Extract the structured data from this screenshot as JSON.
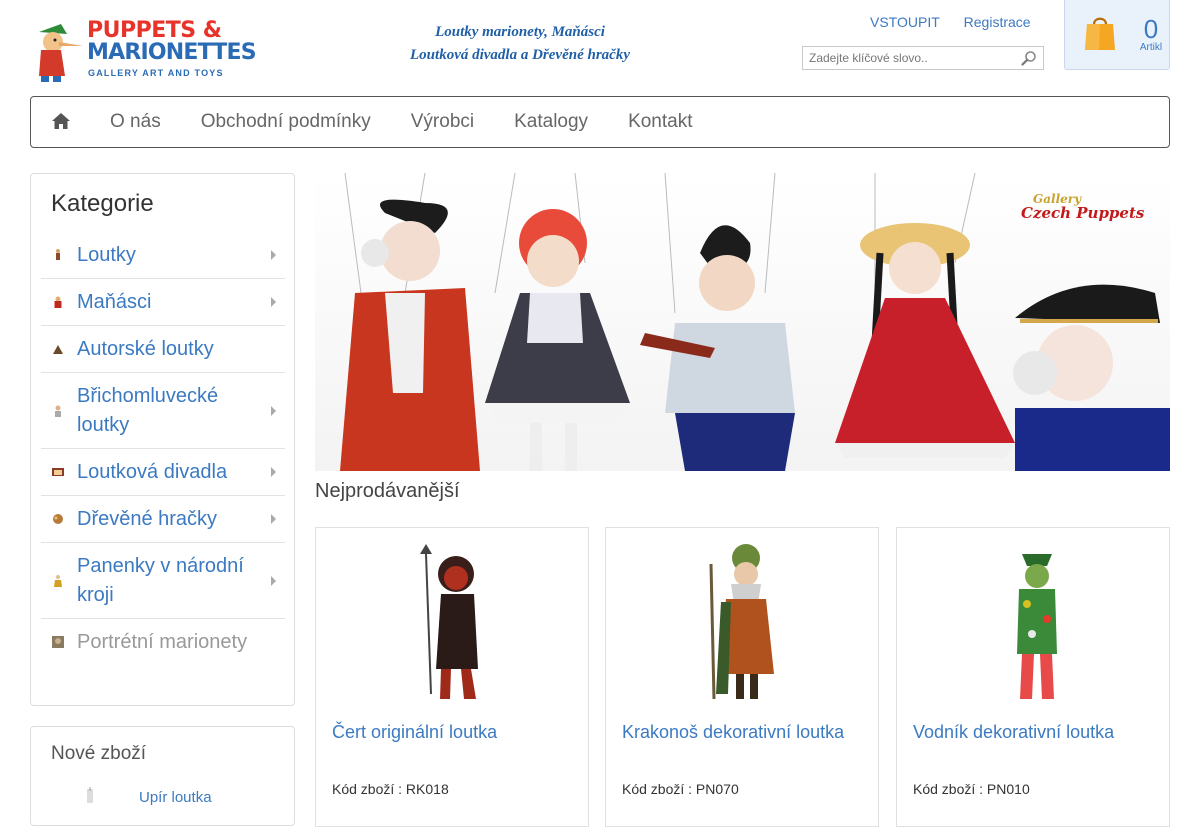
{
  "header": {
    "logo": {
      "line1": "PUPPETS &",
      "line2": "MARIONETTES",
      "line3": "GALLERY ART AND TOYS"
    },
    "tagline_1": "Loutky marionety, Maňásci",
    "tagline_2": "Loutková divadla a Dřevěné hračky",
    "login": "VSTOUPIT",
    "register": "Registrace",
    "search_placeholder": "Zadejte klíčové slovo..",
    "cart": {
      "count": "0",
      "label": "Artikl"
    }
  },
  "nav": {
    "items": [
      "O nás",
      "Obchodní podmínky",
      "Výrobci",
      "Katalogy",
      "Kontakt"
    ]
  },
  "sidebar": {
    "title": "Kategorie",
    "categories": [
      {
        "label": "Loutky",
        "has_sub": true
      },
      {
        "label": "Maňásci",
        "has_sub": true
      },
      {
        "label": "Autorské loutky",
        "has_sub": false
      },
      {
        "label": "Břichomluvecké loutky",
        "has_sub": true
      },
      {
        "label": "Loutková divadla",
        "has_sub": true
      },
      {
        "label": "Dřevěné hračky",
        "has_sub": true
      },
      {
        "label": "Panenky v národní kroji",
        "has_sub": true
      },
      {
        "label": "Portrétní marionety",
        "has_sub": false
      }
    ],
    "new_title": "Nové zboží",
    "new_item": "Upír loutka"
  },
  "banner": {
    "line1": "Gallery",
    "line2": "Czech Puppets"
  },
  "main": {
    "section_title": "Nejprodávanější",
    "products": [
      {
        "name": "Čert originální loutka",
        "code": "Kód zboží : RK018"
      },
      {
        "name": "Krakonoš dekorativní loutka",
        "code": "Kód zboží : PN070"
      },
      {
        "name": "Vodník dekorativní loutka",
        "code": "Kód zboží : PN010"
      }
    ]
  }
}
